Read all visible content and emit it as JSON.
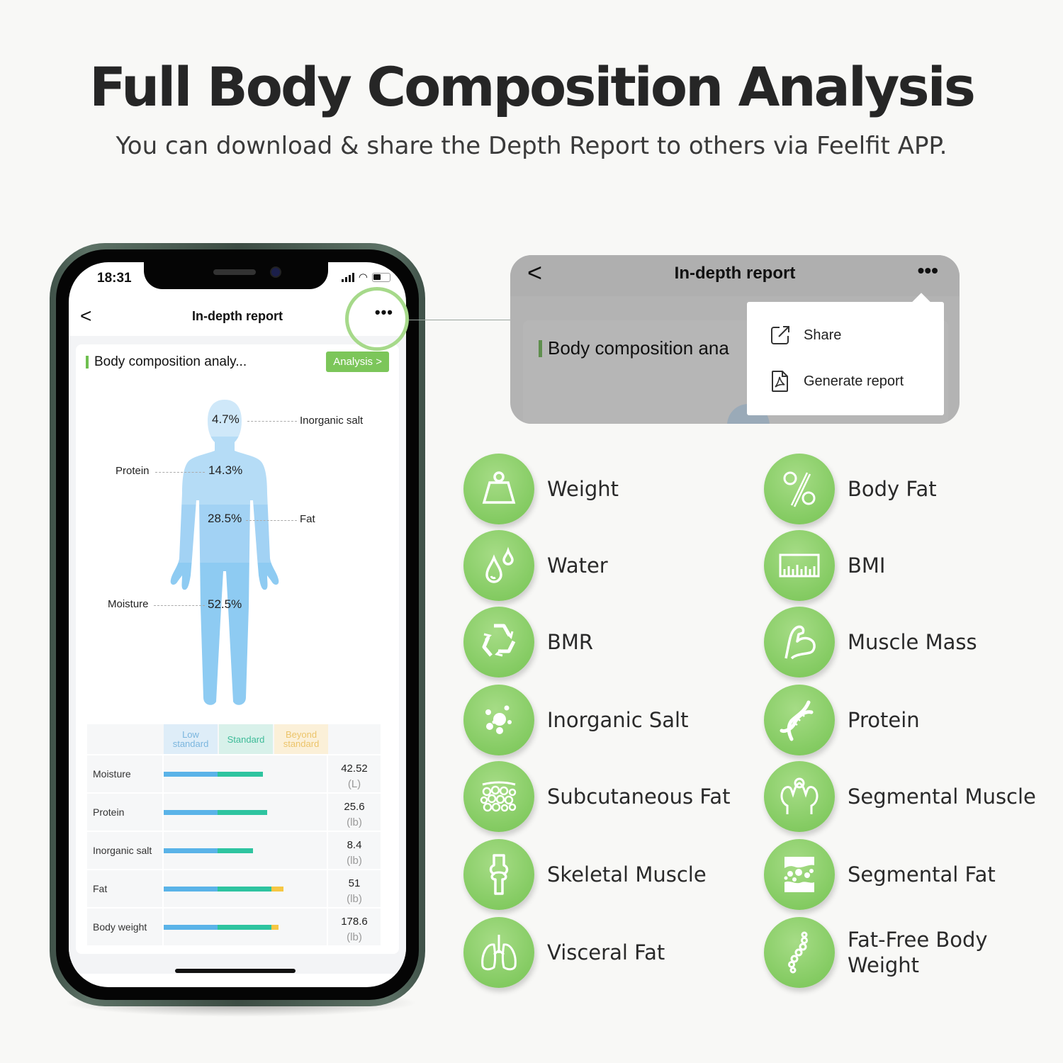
{
  "header": {
    "title": "Full Body Composition Analysis",
    "subtitle": "You can download & share the Depth Report to others via Feelfit APP."
  },
  "phone": {
    "status_time": "18:31",
    "nav": {
      "back": "<",
      "title": "In-depth report",
      "more": "•••"
    },
    "card": {
      "title": "Body composition analy...",
      "analysis_button": "Analysis >"
    },
    "body_figure": {
      "segments": [
        {
          "label": "Inorganic salt",
          "value": "4.7%"
        },
        {
          "label": "Protein",
          "value": "14.3%"
        },
        {
          "label": "Fat",
          "value": "28.5%"
        },
        {
          "label": "Moisture",
          "value": "52.5%"
        }
      ]
    },
    "table": {
      "headers": [
        "Low\nstandard",
        "Standard",
        "Beyond\nstandard"
      ],
      "header_low": "Low standard",
      "header_std": "Standard",
      "header_bey": "Beyond standard",
      "rows": [
        {
          "name": "Moisture",
          "value": "42.52",
          "unit": "(L)",
          "low": 1.0,
          "std": 0.84,
          "bey": 0
        },
        {
          "name": "Protein",
          "value": "25.6",
          "unit": "(lb)",
          "low": 1.0,
          "std": 0.92,
          "bey": 0
        },
        {
          "name": "Inorganic salt",
          "value": "8.4",
          "unit": "(lb)",
          "low": 1.0,
          "std": 0.66,
          "bey": 0
        },
        {
          "name": "Fat",
          "value": "51",
          "unit": "(lb)",
          "low": 1.0,
          "std": 1.0,
          "bey": 0.23
        },
        {
          "name": "Body weight",
          "value": "178.6",
          "unit": "(lb)",
          "low": 1.0,
          "std": 1.0,
          "bey": 0.13
        }
      ],
      "colors": {
        "low": "#5ab3e8",
        "std": "#2ec4a0",
        "bey": "#f6c744"
      }
    }
  },
  "zoom_panel": {
    "back": "<",
    "title": "In-depth report",
    "more": "•••",
    "card_title": "Body composition ana",
    "menu": [
      {
        "icon": "share-icon",
        "label": "Share"
      },
      {
        "icon": "pdf-icon",
        "label": "Generate report"
      }
    ]
  },
  "features": [
    {
      "icon": "weight-icon",
      "label": "Weight"
    },
    {
      "icon": "body-fat-percent-icon",
      "label": "Body Fat"
    },
    {
      "icon": "water-drops-icon",
      "label": "Water"
    },
    {
      "icon": "bmi-ruler-icon",
      "label": "BMI"
    },
    {
      "icon": "bmr-recycle-icon",
      "label": "BMR"
    },
    {
      "icon": "muscle-arm-icon",
      "label": "Muscle Mass"
    },
    {
      "icon": "inorganic-salt-icon",
      "label": "Inorganic Salt"
    },
    {
      "icon": "protein-dna-icon",
      "label": "Protein"
    },
    {
      "icon": "subcutaneous-fat-icon",
      "label": "Subcutaneous Fat"
    },
    {
      "icon": "segmental-muscle-icon",
      "label": "Segmental Muscle"
    },
    {
      "icon": "skeletal-bone-icon",
      "label": "Skeletal Muscle"
    },
    {
      "icon": "segmental-fat-icon",
      "label": "Segmental Fat"
    },
    {
      "icon": "visceral-fat-lungs-icon",
      "label": "Visceral Fat"
    },
    {
      "icon": "spine-icon",
      "label": "Fat-Free Body Weight"
    }
  ],
  "colors": {
    "accent_green": "#7cc65a",
    "body_blue": "#8ecbf2"
  }
}
